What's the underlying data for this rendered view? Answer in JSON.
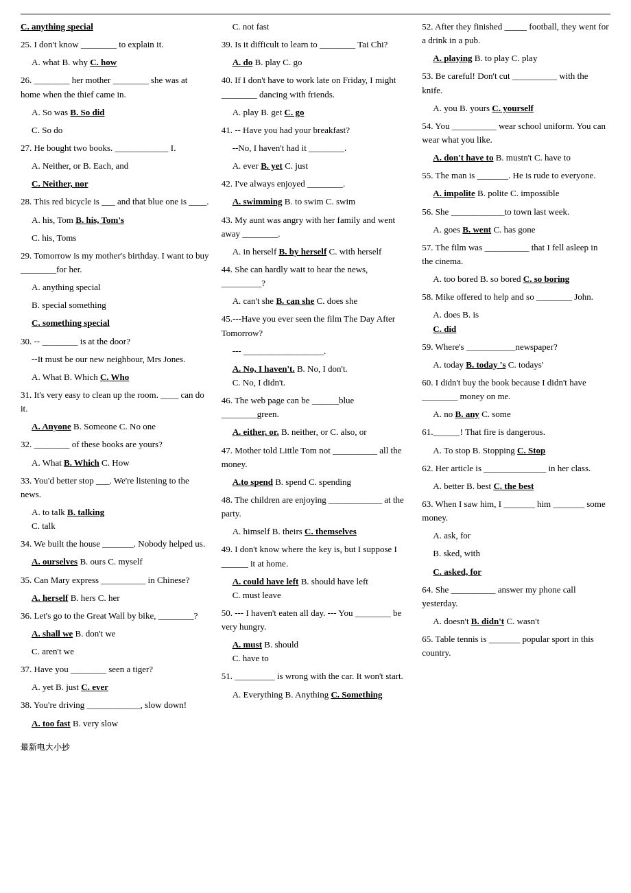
{
  "footer": "最新电大小抄",
  "col1": [
    {
      "type": "header",
      "text": "C. anything special"
    },
    {
      "type": "q",
      "text": "25. I don't know ________ to explain it."
    },
    {
      "type": "opts3",
      "a": "A. what",
      "b": "B. why",
      "c": "C. how",
      "ans": "c"
    },
    {
      "type": "q",
      "text": "26. ________ her mother ________ she was at home when the thief came in."
    },
    {
      "type": "opts2",
      "a": "A. So was",
      "b": "B. So did",
      "ans": "b"
    },
    {
      "type": "indent",
      "text": "C. So do"
    },
    {
      "type": "q",
      "text": "27. He bought two books. ____________ I."
    },
    {
      "type": "opts2",
      "a": "A. Neither, or",
      "b": "B. Each, and",
      "ans": "none"
    },
    {
      "type": "indent",
      "text": "C. Neither, nor",
      "bold": true,
      "underline": true
    },
    {
      "type": "q",
      "text": "28. This red bicycle is ___ and that blue one is ____."
    },
    {
      "type": "opts2",
      "a": "A. his, Tom",
      "b": "B. his, Tom's",
      "ans": "b"
    },
    {
      "type": "indent",
      "text": "C. his, Toms"
    },
    {
      "type": "q",
      "text": "29. Tomorrow is my mother's birthday. I want to buy ________for her."
    },
    {
      "type": "opts2a",
      "a": "A. anything special"
    },
    {
      "type": "opts2b",
      "b": "B. special something"
    },
    {
      "type": "indent",
      "text": "C. something special",
      "bold": true,
      "underline": true
    },
    {
      "type": "q",
      "text": "30. -- ________ is at the door?"
    },
    {
      "type": "indent",
      "text": "--It must be our new neighbour, Mrs Jones."
    },
    {
      "type": "opts3",
      "a": "A. What",
      "b": "B. Which",
      "c": "C. Who",
      "ans": "c",
      "clabel": "C. Who"
    },
    {
      "type": "q",
      "text": "31. It's very easy to clean up the room. ____ can do it."
    },
    {
      "type": "opts3",
      "a": "A. Anyone",
      "b": "B. Someone",
      "c": "C. No one",
      "ans": "a"
    },
    {
      "type": "q",
      "text": "32. ________ of these books are yours?"
    },
    {
      "type": "opts3",
      "a": "A. What",
      "b": "B. Which",
      "c": "C. How",
      "ans": "b"
    },
    {
      "type": "q",
      "text": "33. You'd better stop ___. We're listening to the news."
    },
    {
      "type": "opts3line",
      "a": "A. to talk",
      "b": "B. talking",
      "c": "C. talk",
      "ans": "b"
    },
    {
      "type": "q",
      "text": "34. We built the house _______. Nobody helped us."
    },
    {
      "type": "opts3",
      "a": "A. ourselves",
      "b": "B. ours",
      "c": "C. myself",
      "ans": "a"
    },
    {
      "type": "q",
      "text": "35. Can Mary express __________ in Chinese?"
    },
    {
      "type": "opts3",
      "a": "A. herself",
      "b": "B. hers",
      "c": "C. her",
      "ans": "a"
    },
    {
      "type": "q",
      "text": "36. Let's go to the Great Wall by bike, ________?"
    },
    {
      "type": "opts2",
      "a": "A. shall we",
      "b": "B. don't we",
      "ans": "a"
    },
    {
      "type": "indent",
      "text": "C. aren't we"
    },
    {
      "type": "q",
      "text": "37. Have you ________ seen a tiger?"
    },
    {
      "type": "opts3",
      "a": "A. yet",
      "b": "B. just",
      "c": "C. ever",
      "ans": "c"
    },
    {
      "type": "q",
      "text": "38. You're driving ____________, slow down!"
    },
    {
      "type": "opts2",
      "a": "A. too fast",
      "b": "B. very slow",
      "ans": "a"
    }
  ],
  "col2": [
    {
      "type": "indent",
      "text": "C. not fast"
    },
    {
      "type": "q",
      "text": "39. Is it difficult to learn to ________ Tai Chi?"
    },
    {
      "type": "opts3",
      "a": "A. do",
      "b": "B. play",
      "c": "C. go",
      "ans": "a"
    },
    {
      "type": "q",
      "text": "40. If I don't have to work late on Friday, I might ________ dancing with friends."
    },
    {
      "type": "opts3",
      "a": "A. play",
      "b": "B. get",
      "c": "C. go",
      "ans": "c"
    },
    {
      "type": "q",
      "text": "41. -- Have you had your breakfast?"
    },
    {
      "type": "indent",
      "text": "--No, I haven't had it ________."
    },
    {
      "type": "opts3",
      "a": "A. ever",
      "b": "B. yet",
      "c": "C. just",
      "ans": "b"
    },
    {
      "type": "q",
      "text": "42. I've always enjoyed ________."
    },
    {
      "type": "opts3",
      "a": "A. swimming",
      "b": "B. to swim",
      "c": "C. swim",
      "ans": "a"
    },
    {
      "type": "q",
      "text": "43. My aunt was angry with her family and went away ________."
    },
    {
      "type": "opts3",
      "a": "A. in herself",
      "b": "B. by herself",
      "c": "C. with herself",
      "ans": "b"
    },
    {
      "type": "q",
      "text": "44. She can hardly wait to hear the news, _________?"
    },
    {
      "type": "opts3",
      "a": "A. can't she",
      "b": "B. can she",
      "c": "C. does she",
      "ans": "b"
    },
    {
      "type": "q",
      "text": "45.---Have you ever seen the film The Day After Tomorrow?"
    },
    {
      "type": "indent",
      "text": "--- __________________."
    },
    {
      "type": "opts3line",
      "a": "A. No, I haven't.",
      "b": "B. No, I don't.",
      "c": "C. No, I didn't.",
      "ans": "a"
    },
    {
      "type": "q",
      "text": "46. The web page can be ______blue ________green."
    },
    {
      "type": "opts3",
      "a": "A. either, or.",
      "b": "B. neither, or",
      "c": "C. also, or",
      "ans": "a"
    },
    {
      "type": "q",
      "text": "47. Mother told Little Tom not __________ all the money."
    },
    {
      "type": "opts3",
      "a": "A.to spend",
      "b": "B. spend",
      "c": "C. spending",
      "ans": "a"
    },
    {
      "type": "q",
      "text": "48. The children are enjoying ____________ at the party."
    },
    {
      "type": "opts3",
      "a": "A. himself",
      "b": "B. theirs",
      "c": "C. themselves",
      "ans": "c",
      "clabel": "C. themselves"
    },
    {
      "type": "q",
      "text": "49. I don't know where the key is, but I suppose I ______ it at home."
    },
    {
      "type": "opts3line",
      "a": "A. could have left",
      "b": "B. should have left",
      "c": "C. must leave",
      "ans": "a"
    },
    {
      "type": "q",
      "text": "50. --- I haven't eaten all day. --- You ________ be very hungry."
    },
    {
      "type": "opts3line",
      "a": "A. must",
      "b": "B. should",
      "c": "C. have to",
      "ans": "a"
    },
    {
      "type": "q",
      "text": "51. _________ is wrong with the car. It won't start."
    },
    {
      "type": "opts3",
      "a": "A. Everything",
      "b": "B. Anything",
      "c": "C. Something",
      "ans": "c",
      "clabel": "C. Something"
    }
  ],
  "col3": [
    {
      "type": "q",
      "text": "52. After they finished _____ football, they went for a drink in a pub."
    },
    {
      "type": "opts3",
      "a": "A. playing",
      "b": "B. to play",
      "c": "C. play",
      "ans": "a"
    },
    {
      "type": "q",
      "text": "53. Be careful! Don't cut __________ with the knife."
    },
    {
      "type": "opts3",
      "a": "A. you",
      "b": "B. yours",
      "c": "C. yourself",
      "ans": "c",
      "clabel": "C. yourself"
    },
    {
      "type": "q",
      "text": "54. You __________ wear school uniform. You can wear what you like."
    },
    {
      "type": "opts3",
      "a": "A. don't have to",
      "b": "B. mustn't",
      "c": "C. have to",
      "ans": "a"
    },
    {
      "type": "q",
      "text": "55. The man is _______. He is rude to everyone."
    },
    {
      "type": "opts3",
      "a": "A. impolite",
      "b": "B. polite",
      "c": "C. impossible",
      "ans": "a"
    },
    {
      "type": "q",
      "text": "56. She ____________to town last week."
    },
    {
      "type": "opts3",
      "a": "A. goes",
      "b": "B. went",
      "c": "C. has gone",
      "ans": "b"
    },
    {
      "type": "q",
      "text": "57. The film was __________ that I fell asleep in the cinema."
    },
    {
      "type": "opts3",
      "a": "A. too bored",
      "b": "B. so bored",
      "c": "C. so boring",
      "ans": "c",
      "clabel": "C. so boring"
    },
    {
      "type": "q",
      "text": "58. Mike offered to help and so ________ John."
    },
    {
      "type": "opts3line",
      "a": "A. does",
      "b": "B. is",
      "c": "C. did",
      "ans": "c"
    },
    {
      "type": "q",
      "text": "59. Where's ___________newspaper?"
    },
    {
      "type": "opts3",
      "a": "A. today",
      "b": "B. today 's",
      "c": "C. todays'",
      "ans": "b"
    },
    {
      "type": "q",
      "text": "60. I didn't buy the book because I didn't have ________ money on me."
    },
    {
      "type": "opts3",
      "a": "A. no",
      "b": "B. any",
      "c": "C. some",
      "ans": "b"
    },
    {
      "type": "q",
      "text": "61.______! That fire is dangerous."
    },
    {
      "type": "opts3",
      "a": "A. To stop",
      "b": "B. Stopping",
      "c": "C. Stop",
      "ans": "c"
    },
    {
      "type": "q",
      "text": "62. Her article is ______________ in her class."
    },
    {
      "type": "opts3",
      "a": "A. better",
      "b": "B. best",
      "c": "C. the best",
      "ans": "c"
    },
    {
      "type": "q",
      "text": "63. When I saw him, I _______ him _______ some money."
    },
    {
      "type": "opts2a",
      "a": "A. ask, for"
    },
    {
      "type": "opts2b",
      "b": "B. sked, with"
    },
    {
      "type": "indent",
      "text": "C. asked, for",
      "bold": true,
      "underline": true
    },
    {
      "type": "q",
      "text": "64. She __________ answer my phone call yesterday."
    },
    {
      "type": "opts3",
      "a": "A. doesn't",
      "b": "B. didn't",
      "c": "C. wasn't",
      "ans": "b"
    },
    {
      "type": "q",
      "text": "65. Table tennis is _______ popular sport in this country."
    }
  ]
}
